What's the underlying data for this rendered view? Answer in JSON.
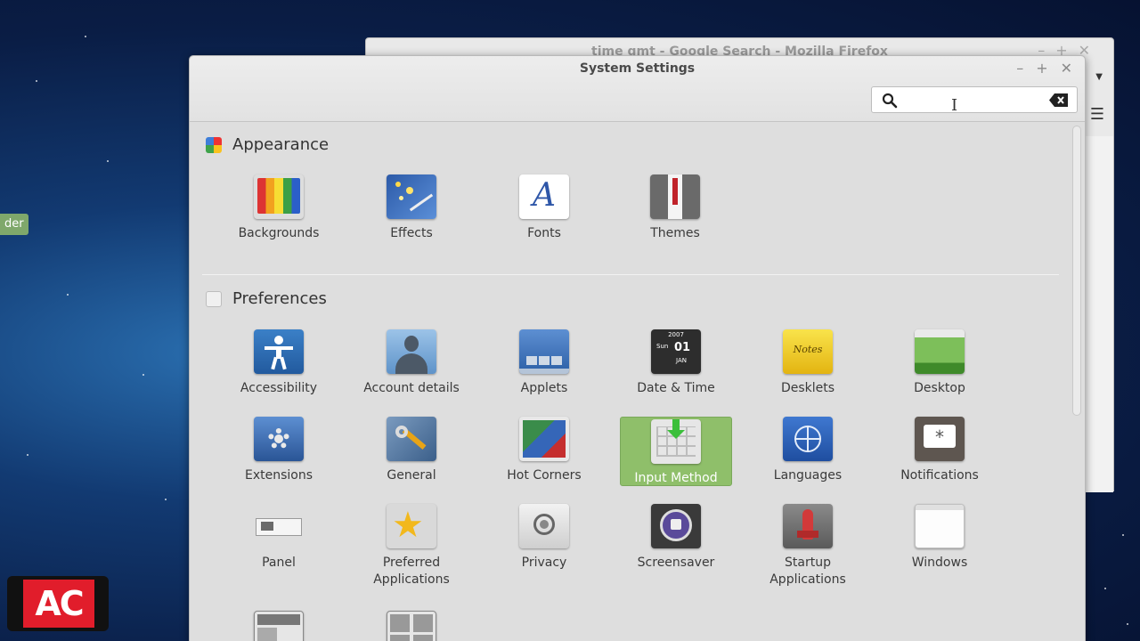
{
  "background_window": {
    "title": "time gmt - Google Search - Mozilla Firefox"
  },
  "desktop_label": "der",
  "window": {
    "title": "System Settings",
    "controls": {
      "minimize": "–",
      "maximize": "+",
      "close": "✕"
    },
    "search": {
      "value": "",
      "placeholder": ""
    }
  },
  "sections": {
    "appearance": {
      "title": "Appearance",
      "items": [
        "Backgrounds",
        "Effects",
        "Fonts",
        "Themes"
      ]
    },
    "preferences": {
      "title": "Preferences",
      "items": [
        "Accessibility",
        "Account details",
        "Applets",
        "Date & Time",
        "Desklets",
        "Desktop",
        "Extensions",
        "General",
        "Hot Corners",
        "Input Method",
        "Languages",
        "Notifications",
        "Panel",
        "Preferred Applications",
        "Privacy",
        "Screensaver",
        "Startup Applications",
        "Windows"
      ],
      "selected": "Input Method"
    }
  },
  "icon_texts": {
    "fonts_glyph": "A",
    "date_year": "2007",
    "date_weekday": "Sun",
    "date_day": "01",
    "date_month": "JAN",
    "desklets_note": "Notes"
  },
  "watermark": "AC",
  "colors": {
    "selected_tile": "#8fbf6a",
    "window_bg": "#dedede",
    "accent_red": "#e11d2b"
  }
}
